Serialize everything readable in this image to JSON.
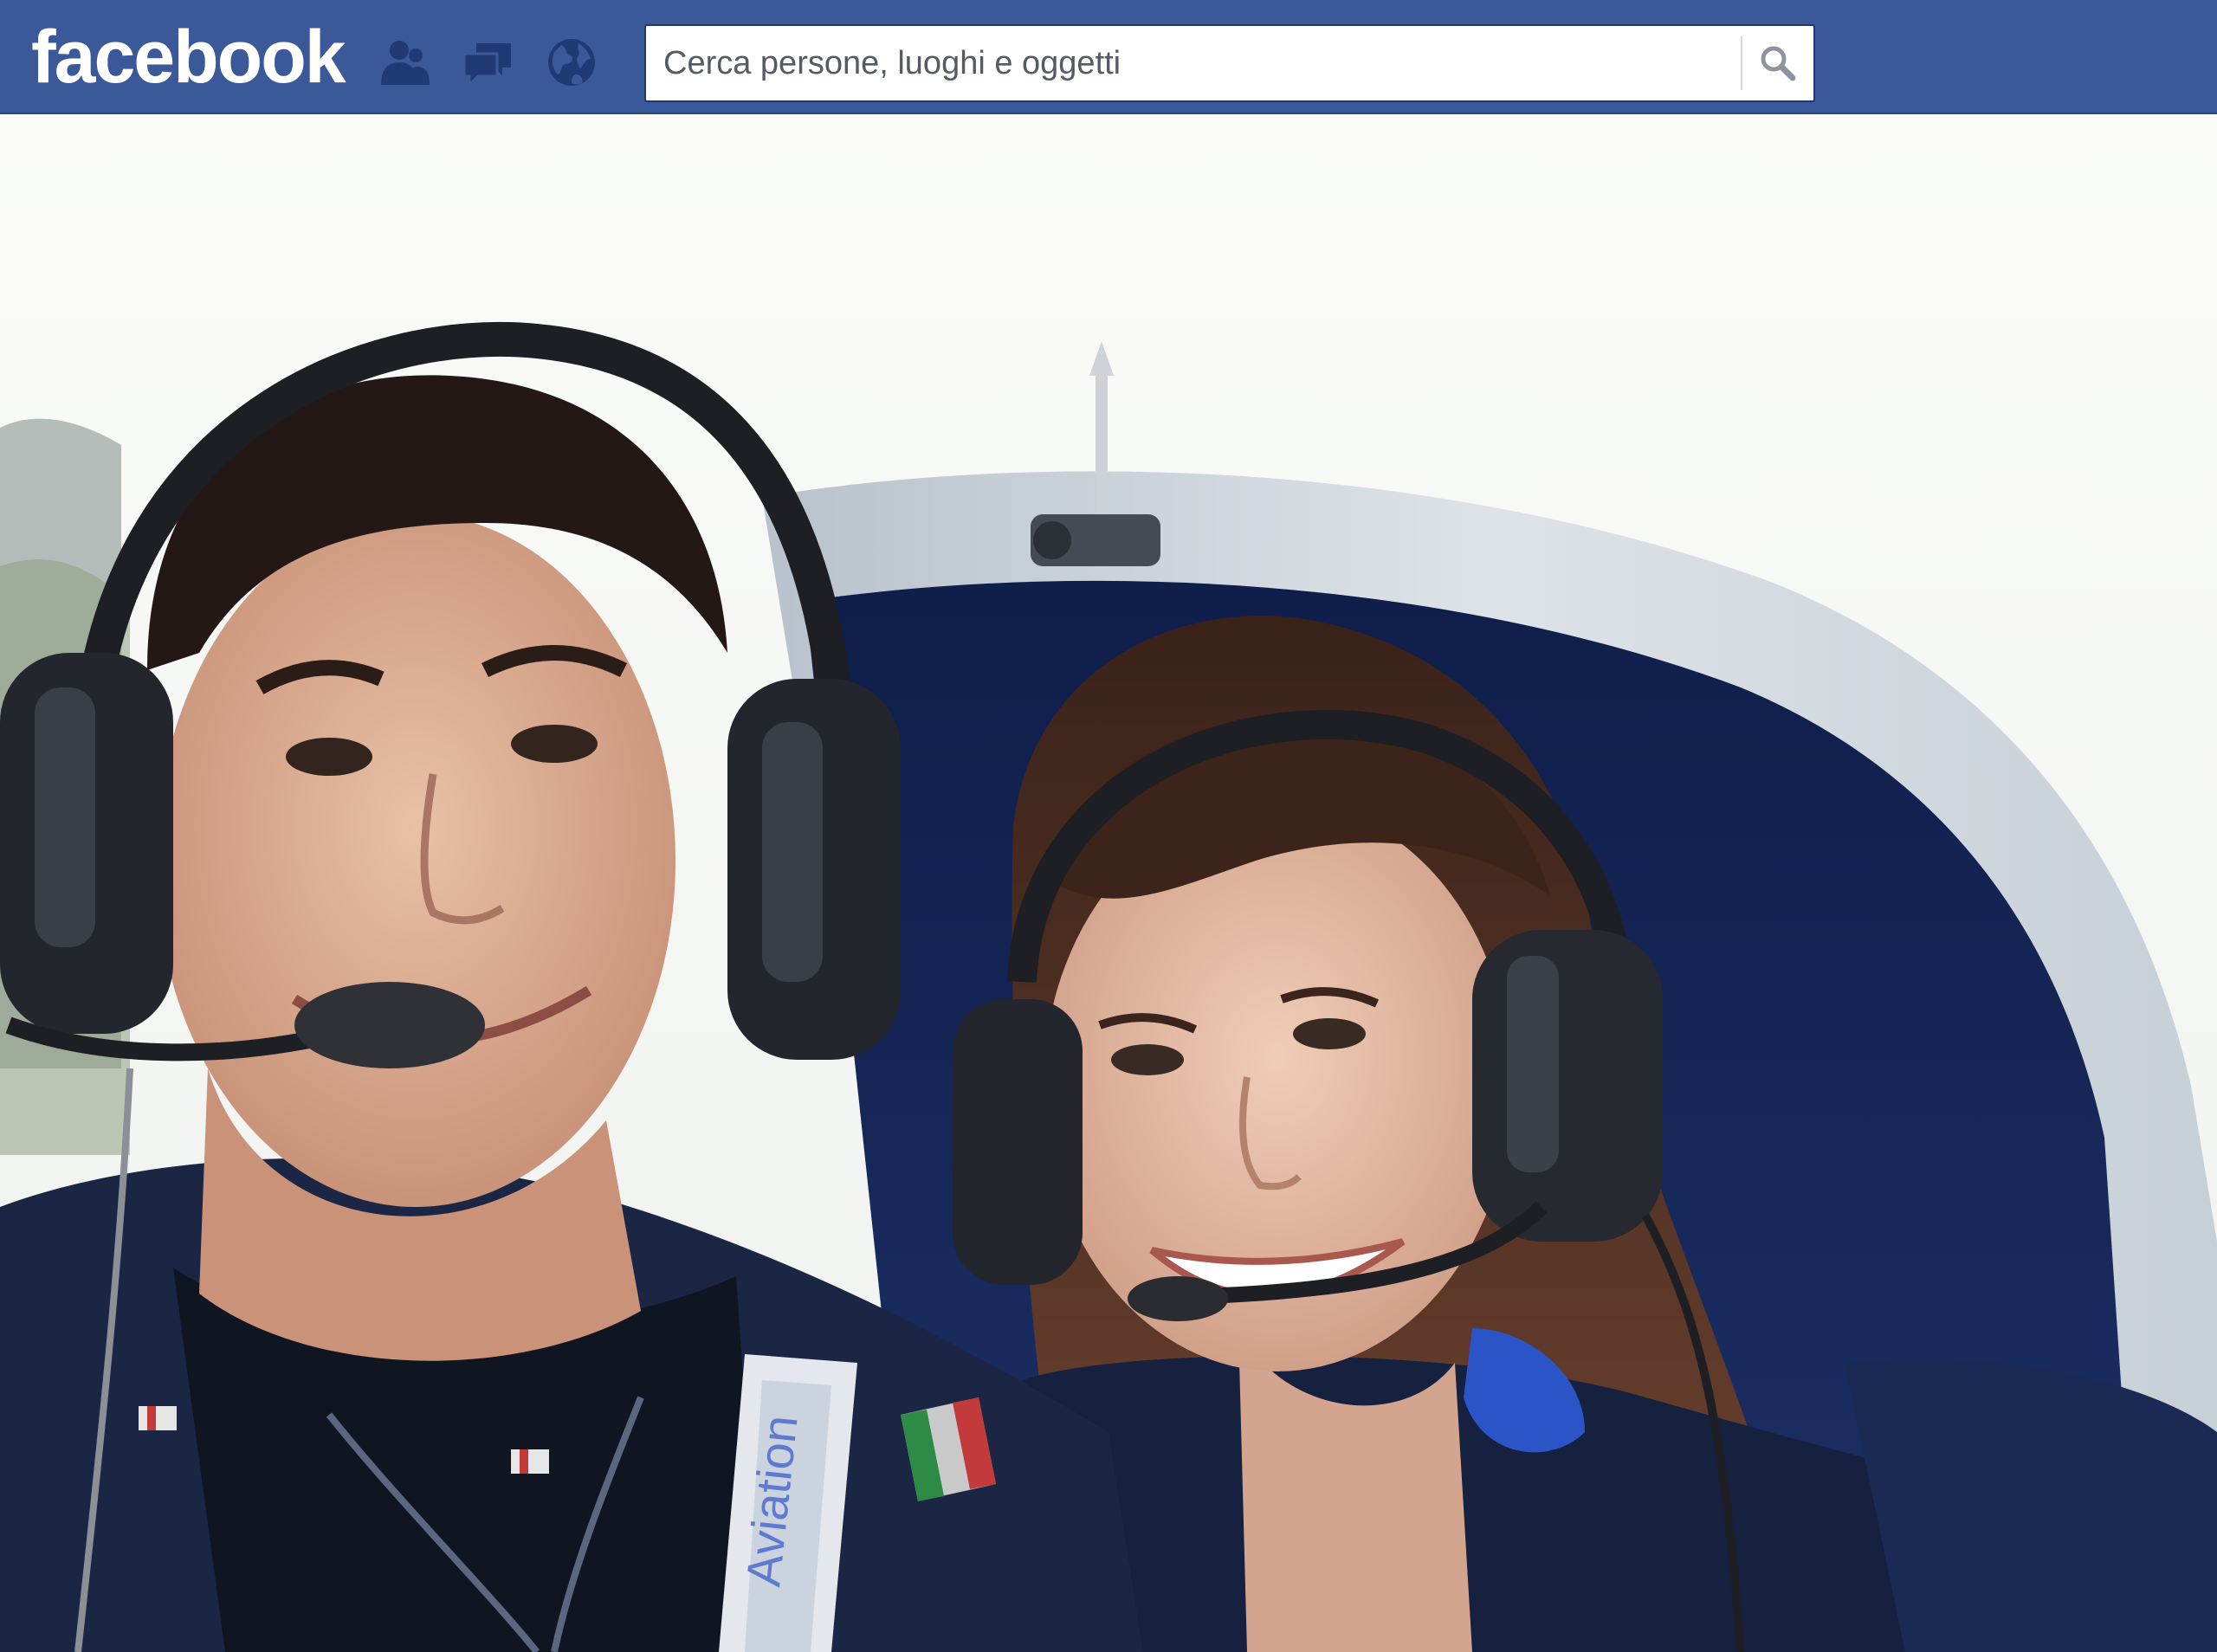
{
  "topbar": {
    "logo_text": "facebook",
    "jewels": [
      {
        "icon": "friends-icon"
      },
      {
        "icon": "messages-icon"
      },
      {
        "icon": "notifications-globe-icon"
      }
    ],
    "search": {
      "placeholder": "Cerca persone, luoghi e oggetti",
      "value": "",
      "button_icon": "search-icon"
    },
    "colors": {
      "bar": "#3b5998",
      "jewel": "#1f3a75"
    }
  },
  "photo": {
    "subject": "selfie-photo",
    "patch_text": "Aviation"
  }
}
